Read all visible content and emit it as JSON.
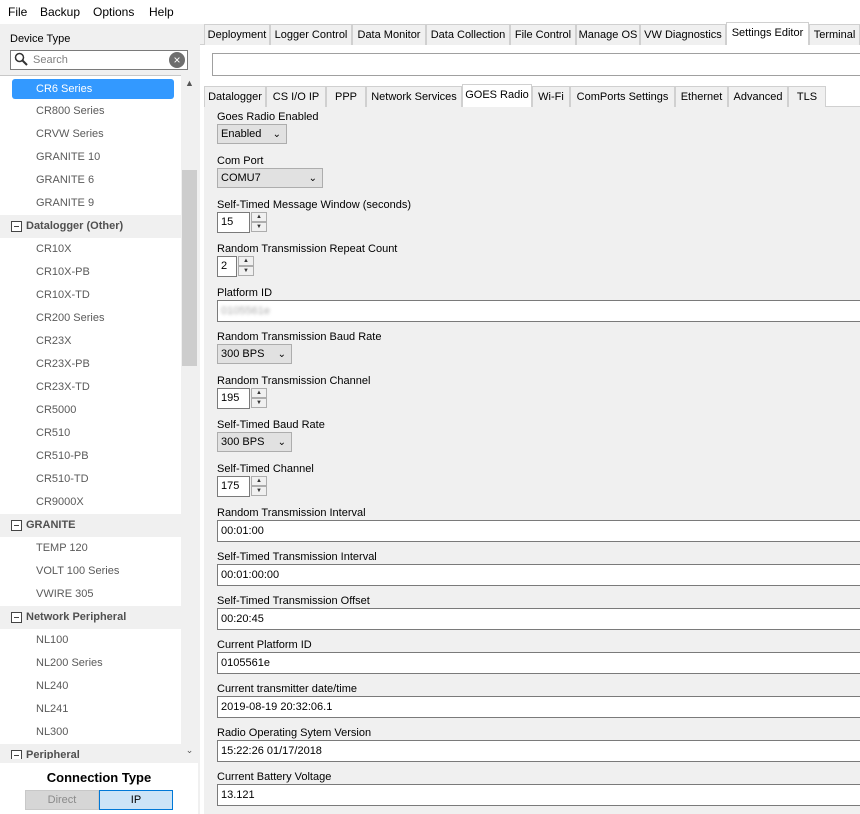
{
  "menu": [
    "File",
    "Backup",
    "Options",
    "Help"
  ],
  "left": {
    "device_type_label": "Device Type",
    "search_placeholder": "Search",
    "tree": [
      {
        "kind": "item",
        "label": "CR6 Series",
        "selected": true
      },
      {
        "kind": "item",
        "label": "CR800 Series"
      },
      {
        "kind": "item",
        "label": "CRVW Series"
      },
      {
        "kind": "item",
        "label": "GRANITE 10"
      },
      {
        "kind": "item",
        "label": "GRANITE 6"
      },
      {
        "kind": "item",
        "label": "GRANITE 9"
      },
      {
        "kind": "group",
        "label": "Datalogger (Other)"
      },
      {
        "kind": "item",
        "label": "CR10X"
      },
      {
        "kind": "item",
        "label": "CR10X-PB"
      },
      {
        "kind": "item",
        "label": "CR10X-TD"
      },
      {
        "kind": "item",
        "label": "CR200 Series"
      },
      {
        "kind": "item",
        "label": "CR23X"
      },
      {
        "kind": "item",
        "label": "CR23X-PB"
      },
      {
        "kind": "item",
        "label": "CR23X-TD"
      },
      {
        "kind": "item",
        "label": "CR5000"
      },
      {
        "kind": "item",
        "label": "CR510"
      },
      {
        "kind": "item",
        "label": "CR510-PB"
      },
      {
        "kind": "item",
        "label": "CR510-TD"
      },
      {
        "kind": "item",
        "label": "CR9000X"
      },
      {
        "kind": "group",
        "label": "GRANITE"
      },
      {
        "kind": "item",
        "label": "TEMP 120"
      },
      {
        "kind": "item",
        "label": "VOLT 100 Series"
      },
      {
        "kind": "item",
        "label": "VWIRE 305"
      },
      {
        "kind": "group",
        "label": "Network Peripheral"
      },
      {
        "kind": "item",
        "label": "NL100"
      },
      {
        "kind": "item",
        "label": "NL200 Series"
      },
      {
        "kind": "item",
        "label": "NL240"
      },
      {
        "kind": "item",
        "label": "NL241"
      },
      {
        "kind": "item",
        "label": "NL300"
      },
      {
        "kind": "group",
        "label": "Peripheral"
      }
    ],
    "connection_type_title": "Connection Type",
    "direct_label": "Direct",
    "ip_label": "IP"
  },
  "main_tabs": [
    "Deployment",
    "Logger Control",
    "Data Monitor",
    "Data Collection",
    "File Control",
    "Manage OS",
    "VW Diagnostics",
    "Settings Editor",
    "Terminal"
  ],
  "main_tab_active": "Settings Editor",
  "sub_tabs": [
    "Datalogger",
    "CS I/O IP",
    "PPP",
    "Network Services",
    "GOES Radio",
    "Wi-Fi",
    "ComPorts Settings",
    "Ethernet",
    "Advanced",
    "TLS"
  ],
  "sub_tab_active": "GOES Radio",
  "fields": [
    {
      "kind": "select",
      "label": "Goes Radio Enabled",
      "value": "Enabled"
    },
    {
      "kind": "select",
      "label": "Com Port",
      "value": "COMU7"
    },
    {
      "kind": "spin",
      "label": "Self-Timed Message Window (seconds)",
      "value": "15"
    },
    {
      "kind": "spin",
      "label": "Random Transmission Repeat Count",
      "value": "2"
    },
    {
      "kind": "text",
      "label": "Platform ID",
      "value": "0105561e",
      "blurred": true
    },
    {
      "kind": "select",
      "label": "Random Transmission Baud Rate",
      "value": "300 BPS"
    },
    {
      "kind": "spin",
      "label": "Random Transmission Channel",
      "value": "195"
    },
    {
      "kind": "select",
      "label": "Self-Timed Baud Rate",
      "value": "300 BPS"
    },
    {
      "kind": "spin",
      "label": "Self-Timed Channel",
      "value": "175"
    },
    {
      "kind": "text",
      "label": "Random Transmission Interval",
      "value": "00:01:00"
    },
    {
      "kind": "text",
      "label": "Self-Timed Transmission Interval",
      "value": "00:01:00:00"
    },
    {
      "kind": "text",
      "label": "Self-Timed Transmission Offset",
      "value": "00:20:45"
    },
    {
      "kind": "text",
      "label": "Current Platform ID",
      "value": "0105561e"
    },
    {
      "kind": "text",
      "label": "Current transmitter date/time",
      "value": "2019-08-19 20:32:06.1"
    },
    {
      "kind": "text",
      "label": "Radio Operating Sytem Version",
      "value": "15:22:26 01/17/2018"
    },
    {
      "kind": "text",
      "label": "Current Battery Voltage",
      "value": "13.121"
    }
  ]
}
